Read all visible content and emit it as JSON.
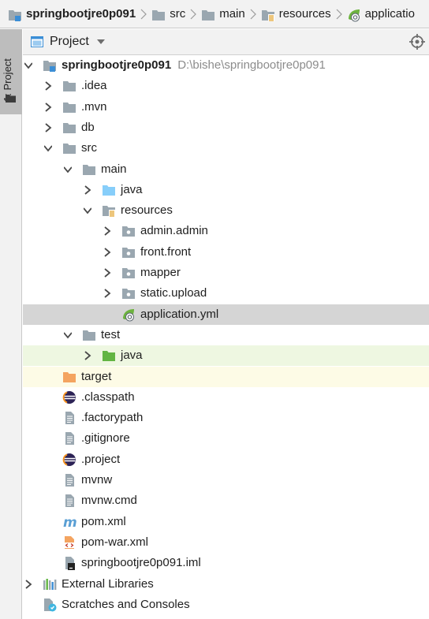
{
  "breadcrumb": {
    "items": [
      {
        "label": "springbootjre0p091",
        "icon": "module-folder-icon"
      },
      {
        "label": "src",
        "icon": "folder-icon"
      },
      {
        "label": "main",
        "icon": "folder-icon"
      },
      {
        "label": "resources",
        "icon": "resources-folder-icon"
      },
      {
        "label": "applicatio",
        "icon": "spring-yml-icon"
      }
    ]
  },
  "tool_stripe": {
    "tab_label": "1: Project"
  },
  "panel": {
    "title": "Project"
  },
  "tree": [
    {
      "label": "springbootjre0p091",
      "hint": "D:\\bishe\\springbootjre0p091",
      "icon": "module-folder-icon",
      "depth": 0,
      "arrow": "down",
      "bold": true
    },
    {
      "label": ".idea",
      "icon": "folder-icon",
      "depth": 1,
      "arrow": "right"
    },
    {
      "label": ".mvn",
      "icon": "folder-icon",
      "depth": 1,
      "arrow": "right"
    },
    {
      "label": "db",
      "icon": "folder-icon",
      "depth": 1,
      "arrow": "right"
    },
    {
      "label": "src",
      "icon": "folder-icon",
      "depth": 1,
      "arrow": "down"
    },
    {
      "label": "main",
      "icon": "folder-icon",
      "depth": 2,
      "arrow": "down"
    },
    {
      "label": "java",
      "icon": "source-folder-icon",
      "depth": 3,
      "arrow": "right"
    },
    {
      "label": "resources",
      "icon": "resources-folder-icon",
      "depth": 3,
      "arrow": "down"
    },
    {
      "label": "admin.admin",
      "icon": "package-folder-icon",
      "depth": 4,
      "arrow": "right"
    },
    {
      "label": "front.front",
      "icon": "package-folder-icon",
      "depth": 4,
      "arrow": "right"
    },
    {
      "label": "mapper",
      "icon": "package-folder-icon",
      "depth": 4,
      "arrow": "right"
    },
    {
      "label": "static.upload",
      "icon": "package-folder-icon",
      "depth": 4,
      "arrow": "right"
    },
    {
      "label": "application.yml",
      "icon": "spring-yml-icon",
      "depth": 4,
      "arrow": "none",
      "state": "selected"
    },
    {
      "label": "test",
      "icon": "folder-icon",
      "depth": 2,
      "arrow": "down"
    },
    {
      "label": "java",
      "icon": "test-source-folder-icon",
      "depth": 3,
      "arrow": "right",
      "state": "vcs-new"
    },
    {
      "label": "target",
      "icon": "excluded-folder-icon",
      "depth": 1,
      "arrow": "none",
      "state": "excluded"
    },
    {
      "label": ".classpath",
      "icon": "eclipse-icon",
      "depth": 1,
      "arrow": "none"
    },
    {
      "label": ".factorypath",
      "icon": "text-file-icon",
      "depth": 1,
      "arrow": "none"
    },
    {
      "label": ".gitignore",
      "icon": "text-file-icon",
      "depth": 1,
      "arrow": "none"
    },
    {
      "label": ".project",
      "icon": "eclipse-icon",
      "depth": 1,
      "arrow": "none"
    },
    {
      "label": "mvnw",
      "icon": "text-file-icon",
      "depth": 1,
      "arrow": "none"
    },
    {
      "label": "mvnw.cmd",
      "icon": "text-file-icon",
      "depth": 1,
      "arrow": "none"
    },
    {
      "label": "pom.xml",
      "icon": "maven-icon",
      "depth": 1,
      "arrow": "none"
    },
    {
      "label": "pom-war.xml",
      "icon": "xml-file-icon",
      "depth": 1,
      "arrow": "none"
    },
    {
      "label": "springbootjre0p091.iml",
      "icon": "iml-file-icon",
      "depth": 1,
      "arrow": "none"
    },
    {
      "label": "External Libraries",
      "icon": "libraries-icon",
      "depth": 0,
      "arrow": "right"
    },
    {
      "label": "Scratches and Consoles",
      "icon": "scratches-icon",
      "depth": 0,
      "arrow": "none"
    }
  ],
  "colors": {
    "folder": "#9aa7b0",
    "source_folder": "#87cefa",
    "test_folder": "#62b543",
    "excluded_folder": "#f4a460",
    "spring": "#6db33f",
    "maven": "#5a9fd4",
    "selection": "#d5d5d5"
  }
}
